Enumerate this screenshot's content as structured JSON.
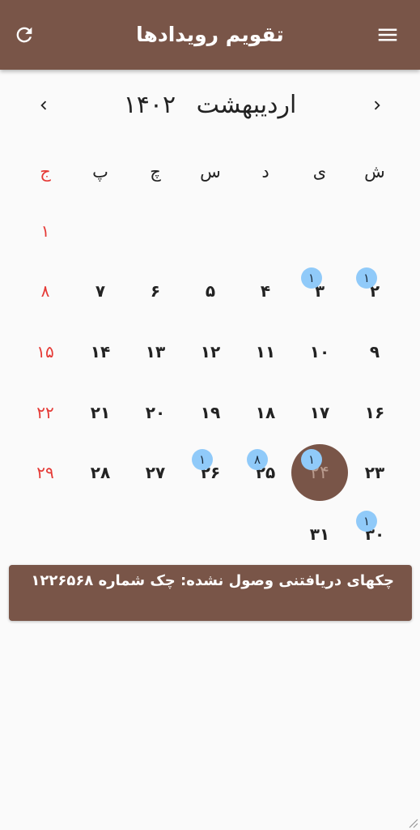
{
  "app_bar": {
    "title": "تقویم رویدادها",
    "refresh_icon": "refresh-icon",
    "menu_icon": "menu-icon"
  },
  "calendar": {
    "month_name": "اردیبهشت",
    "year": "۱۴۰۲",
    "weekdays": [
      "ش",
      "ی",
      "د",
      "س",
      "چ",
      "پ",
      "ج"
    ],
    "weeks": [
      [
        "",
        "",
        "",
        "",
        "",
        "",
        "۱"
      ],
      [
        "۲",
        "۳",
        "۴",
        "۵",
        "۶",
        "۷",
        "۸"
      ],
      [
        "۹",
        "۱۰",
        "۱۱",
        "۱۲",
        "۱۳",
        "۱۴",
        "۱۵"
      ],
      [
        "۱۶",
        "۱۷",
        "۱۸",
        "۱۹",
        "۲۰",
        "۲۱",
        "۲۲"
      ],
      [
        "۲۳",
        "۲۴",
        "۲۵",
        "۲۶",
        "۲۷",
        "۲۸",
        "۲۹"
      ],
      [
        "۳۰",
        "۳۱",
        "",
        "",
        "",
        "",
        ""
      ]
    ],
    "selected_day": "۲۴",
    "event_badges": [
      {
        "day": "۲",
        "count": "۱"
      },
      {
        "day": "۳",
        "count": "۱"
      },
      {
        "day": "۲۴",
        "count": "۱"
      },
      {
        "day": "۲۵",
        "count": "۸"
      },
      {
        "day": "۲۶",
        "count": "۱"
      },
      {
        "day": "۳۰",
        "count": "۱"
      }
    ],
    "colors": {
      "primary": "#795548",
      "holiday": "#e53935",
      "badge": "#90caf9"
    }
  },
  "event": {
    "text": "چکهای دریافتنی وصول نشده: چک شماره ۱۲۲۶۵۶۸"
  }
}
